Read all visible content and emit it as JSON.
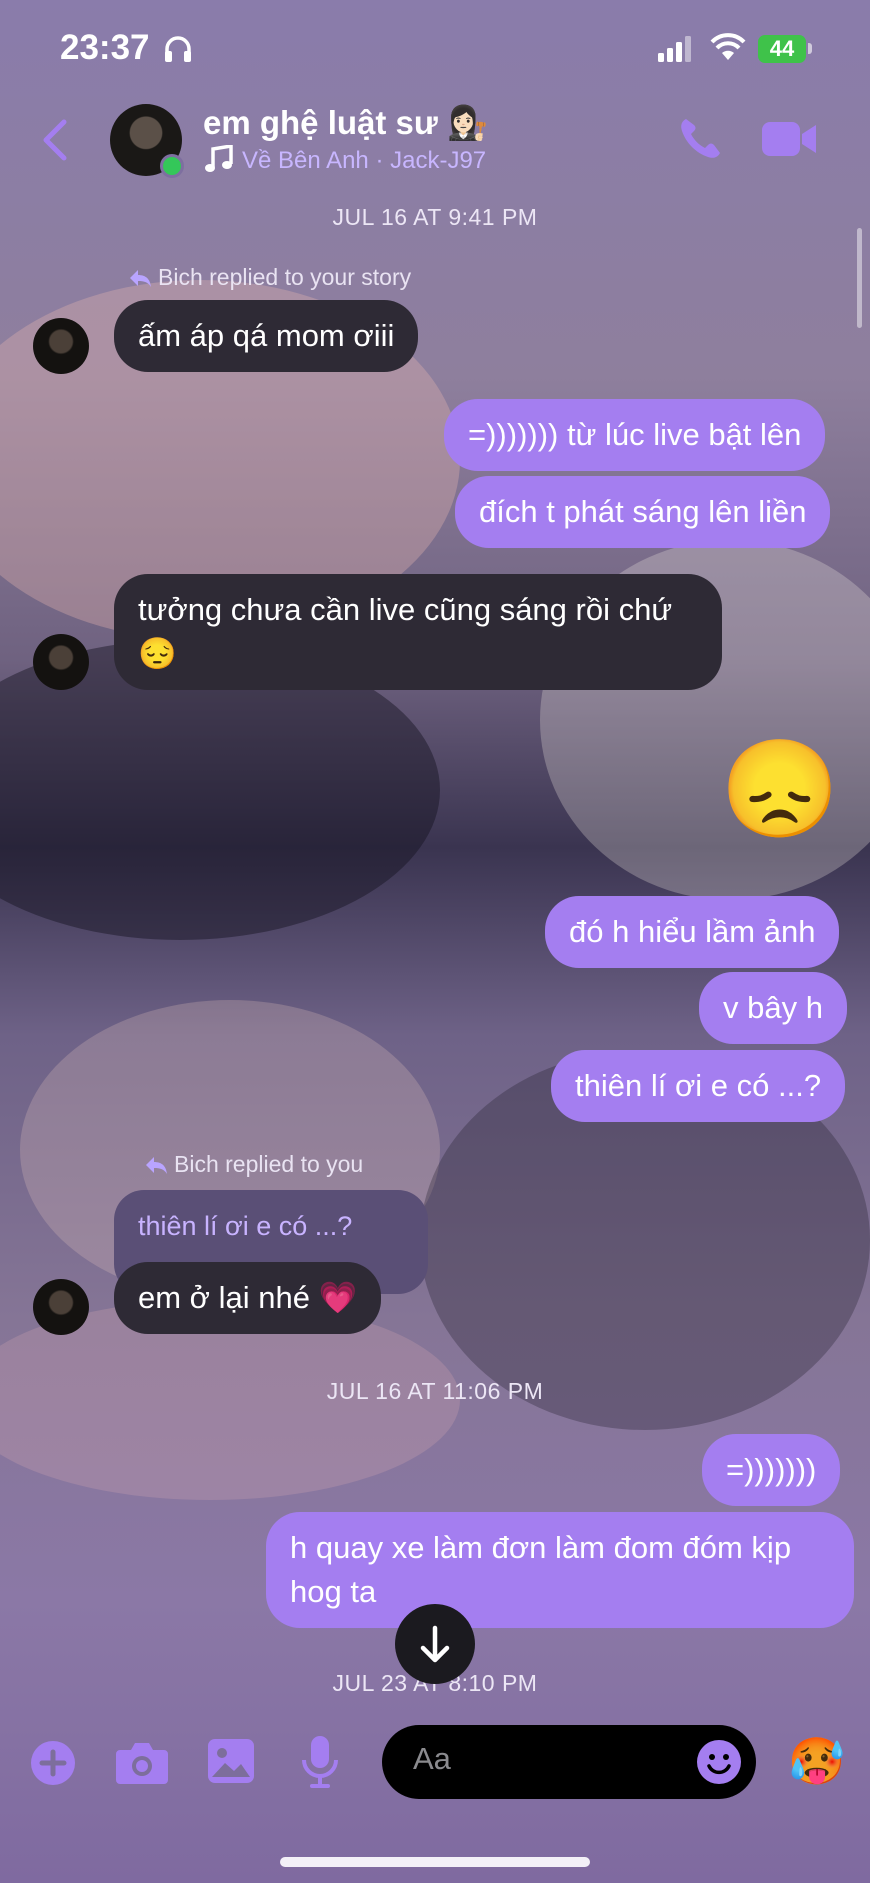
{
  "status_bar": {
    "time": "23:37",
    "battery": "44"
  },
  "header": {
    "contact_name": "em ghệ luật sư 👩🏻‍⚖️",
    "song": "Về Bên Anh · Jack-J97"
  },
  "messages": {
    "ts1": "JUL 16 AT 9:41 PM",
    "reply_note_1": "Bich replied to your story",
    "in1": "ấm áp qá mom ơiii",
    "out1": "=))))))) từ lúc live bật lên",
    "out2": "đích t phát sáng lên liền",
    "in2_line1": "tưởng chưa cần live cũng sáng rồi chứ",
    "in2_line2": "😔",
    "big_emoji": "😞",
    "out3": "đó h hiểu lầm ảnh",
    "out4": "v bây h",
    "out5": "thiên lí ơi e có ...?",
    "reply_note_2": "Bich replied to you",
    "quoted": "thiên lí ơi e có ...?",
    "in3": "em ở lại nhé 💗",
    "ts2": "JUL 16 AT 11:06 PM",
    "out6": "=)))))))",
    "out7_line1": "h quay xe làm đơn làm đom đóm kịp",
    "out7_line2": "hog ta",
    "ts3": "JUL 23 AT 8:10 PM"
  },
  "composer": {
    "placeholder": "Aa",
    "quick_reaction": "🥵"
  },
  "colors": {
    "outgoing_bubble": "#a47ef0",
    "incoming_bubble": "#2e2a35",
    "accent": "#a47ef0"
  }
}
